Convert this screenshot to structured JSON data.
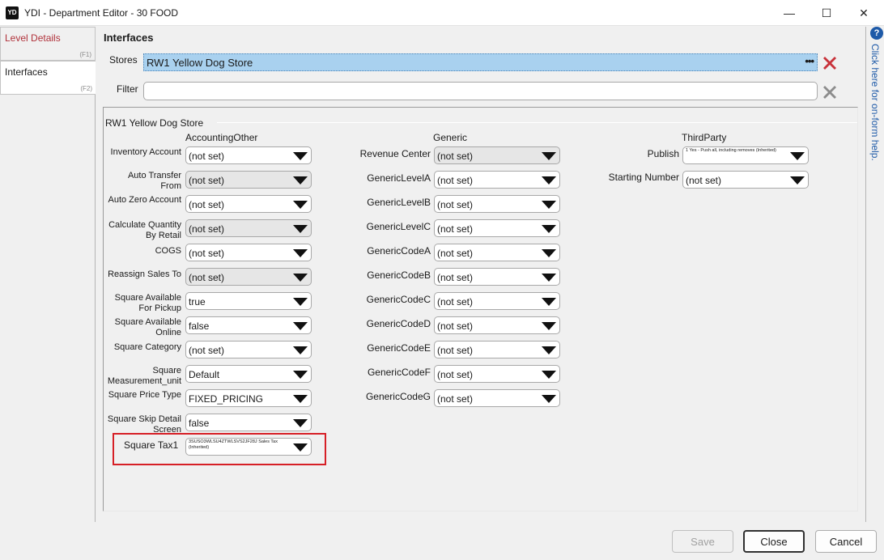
{
  "window": {
    "icon_text": "YD",
    "title": "YDI - Department Editor - 30 FOOD",
    "minimize": "—",
    "maximize": "☐",
    "close": "✕"
  },
  "tabs": [
    {
      "label": "Level Details",
      "key": "(F1)"
    },
    {
      "label": "Interfaces",
      "key": "(F2)"
    }
  ],
  "page": {
    "heading": "Interfaces"
  },
  "stores": {
    "label": "Stores",
    "value": "RW1 Yellow Dog Store",
    "more": "•••"
  },
  "filter": {
    "label": "Filter",
    "value": "",
    "placeholder": ""
  },
  "group": {
    "title": "RW1 Yellow Dog Store"
  },
  "sections": {
    "accounting_other": {
      "title": "AccountingOther",
      "rows": [
        {
          "label": "Inventory Account",
          "value": "(not set)"
        },
        {
          "label": "Auto Transfer From",
          "value": "(not set)"
        },
        {
          "label": "Auto Zero Account",
          "value": "(not set)"
        },
        {
          "label": "Calculate Quantity By Retail",
          "value": "(not set)"
        },
        {
          "label": "COGS",
          "value": "(not set)"
        },
        {
          "label": "Reassign Sales To",
          "value": "(not set)"
        },
        {
          "label": "Square Available For Pickup",
          "value": "true"
        },
        {
          "label": "Square Available Online",
          "value": "false"
        },
        {
          "label": "Square Category",
          "value": "(not set)"
        },
        {
          "label": "Square Measurement_unit",
          "value": "Default"
        },
        {
          "label": "Square Price Type",
          "value": "FIXED_PRICING"
        },
        {
          "label": "Square Skip Detail Screen",
          "value": "false"
        },
        {
          "label": "Square Tax1",
          "value": "3SUSO3WLSU4ZTWLSVS2JF28J Sales Tax (Inherited)"
        }
      ]
    },
    "generic": {
      "title": "Generic",
      "rows": [
        {
          "label": "Revenue Center",
          "value": "(not set)"
        },
        {
          "label": "GenericLevelA",
          "value": "(not set)"
        },
        {
          "label": "GenericLevelB",
          "value": "(not set)"
        },
        {
          "label": "GenericLevelC",
          "value": "(not set)"
        },
        {
          "label": "GenericCodeA",
          "value": "(not set)"
        },
        {
          "label": "GenericCodeB",
          "value": "(not set)"
        },
        {
          "label": "GenericCodeC",
          "value": "(not set)"
        },
        {
          "label": "GenericCodeD",
          "value": "(not set)"
        },
        {
          "label": "GenericCodeE",
          "value": "(not set)"
        },
        {
          "label": "GenericCodeF",
          "value": "(not set)"
        },
        {
          "label": "GenericCodeG",
          "value": "(not set)"
        }
      ]
    },
    "third_party": {
      "title": "ThirdParty",
      "rows": [
        {
          "label": "Publish",
          "value": "1 Yes - Push all, including removes (Inherited)"
        },
        {
          "label": "Starting Number",
          "value": "(not set)"
        }
      ]
    }
  },
  "help": {
    "icon": "?",
    "text": "Click here for on-form help."
  },
  "buttons": {
    "save": "Save",
    "close": "Close",
    "cancel": "Cancel"
  },
  "colors": {
    "highlight": "#d61f26",
    "selection": "#a9d1ef",
    "help_blue": "#1e5aa8",
    "tab_red": "#b0313a"
  }
}
